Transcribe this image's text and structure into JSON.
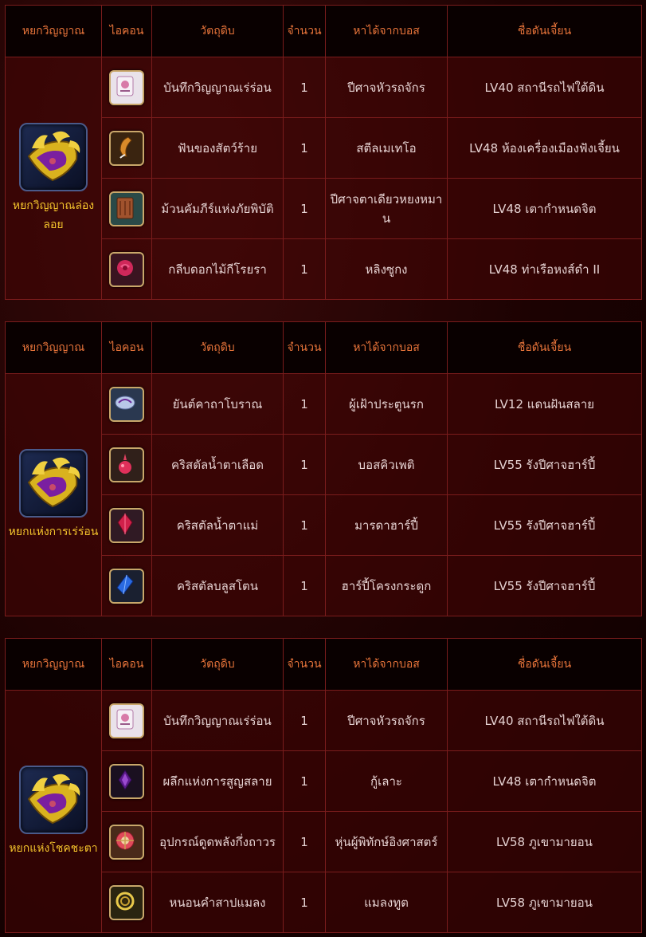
{
  "headers": {
    "jade": "หยกวิญญาณ",
    "icon": "ไอคอน",
    "material": "วัตถุดิบ",
    "qty": "จำนวน",
    "boss": "หาได้จากบอส",
    "dungeon": "ชื่อดันเจี้ยน"
  },
  "colors": {
    "header_text": "#e8743a",
    "jade_name": "#f3c32c",
    "body_text": "#e6d3d3",
    "border": "#7a1c1c"
  },
  "tables": [
    {
      "jade_name": "หยกวิญญาณล่องลอย",
      "jade_icon": "spirit-jade-icon",
      "rows": [
        {
          "icon": "spirit-record-icon",
          "material": "บันทึกวิญญาณเร่ร่อน",
          "qty": "1",
          "boss": "ปีศาจหัวรถจักร",
          "dungeon": "LV40 สถานีรถไฟใต้ดิน"
        },
        {
          "icon": "beast-fang-icon",
          "material": "ฟันของสัตว์ร้าย",
          "qty": "1",
          "boss": "สตีลเมเทโอ",
          "dungeon": "LV48 ห้องเครื่องเมืองฟังเจี้ยน"
        },
        {
          "icon": "disaster-scroll-icon",
          "material": "ม้วนคัมภีร์แห่งภัยพิบัติ",
          "qty": "1",
          "boss": "ปีศาจตาเดียวหยงหมาน",
          "dungeon": "LV48 เตากำหนดจิต"
        },
        {
          "icon": "rose-petal-icon",
          "material": "กลีบดอกไม้กีโรยรา",
          "qty": "1",
          "boss": "หลิงซูกง",
          "dungeon": "LV48 ท่าเรือหงส์ดำ II"
        }
      ]
    },
    {
      "jade_name": "หยกแห่งการเร่ร่อน",
      "jade_icon": "wandering-jade-icon",
      "rows": [
        {
          "icon": "ancient-talisman-icon",
          "material": "ยันต์คาถาโบราณ",
          "qty": "1",
          "boss": "ผู้เฝ้าประตูนรก",
          "dungeon": "LV12 แดนฝันสลาย"
        },
        {
          "icon": "blood-tear-crystal-icon",
          "material": "คริสตัลน้ำตาเลือด",
          "qty": "1",
          "boss": "บอสคิวเพติ",
          "dungeon": "LV55 รังปีศาจฮาร์ปี้"
        },
        {
          "icon": "mother-tear-crystal-icon",
          "material": "คริสตัลน้ำตาแม่",
          "qty": "1",
          "boss": "มารดาฮาร์ปี้",
          "dungeon": "LV55 รังปีศาจฮาร์ปี้"
        },
        {
          "icon": "blue-stone-crystal-icon",
          "material": "คริสตัลบลูสโตน",
          "qty": "1",
          "boss": "ฮาร์ปี้โครงกระดูก",
          "dungeon": "LV55 รังปีศาจฮาร์ปี้"
        }
      ]
    },
    {
      "jade_name": "หยกแห่งโชคชะตา",
      "jade_icon": "destiny-jade-icon",
      "rows": [
        {
          "icon": "spirit-record-icon",
          "material": "บันทึกวิญญาณเร่ร่อน",
          "qty": "1",
          "boss": "ปีศาจหัวรถจักร",
          "dungeon": "LV40 สถานีรถไฟใต้ดิน"
        },
        {
          "icon": "vanishing-seal-icon",
          "material": "ผลึกแห่งการสูญสลาย",
          "qty": "1",
          "boss": "กู้เลาะ",
          "dungeon": "LV48 เตากำหนดจิต"
        },
        {
          "icon": "energy-absorber-icon",
          "material": "อุปกรณ์ดูดพลังกึ่งถาวร",
          "qty": "1",
          "boss": "หุ่นผู้พิทักษ์อิงศาสตร์",
          "dungeon": "LV58 ภูเขามายอน"
        },
        {
          "icon": "cursed-worm-icon",
          "material": "หนอนคำสาปแมลง",
          "qty": "1",
          "boss": "แมลงทูต",
          "dungeon": "LV58 ภูเขามายอน"
        }
      ]
    }
  ]
}
